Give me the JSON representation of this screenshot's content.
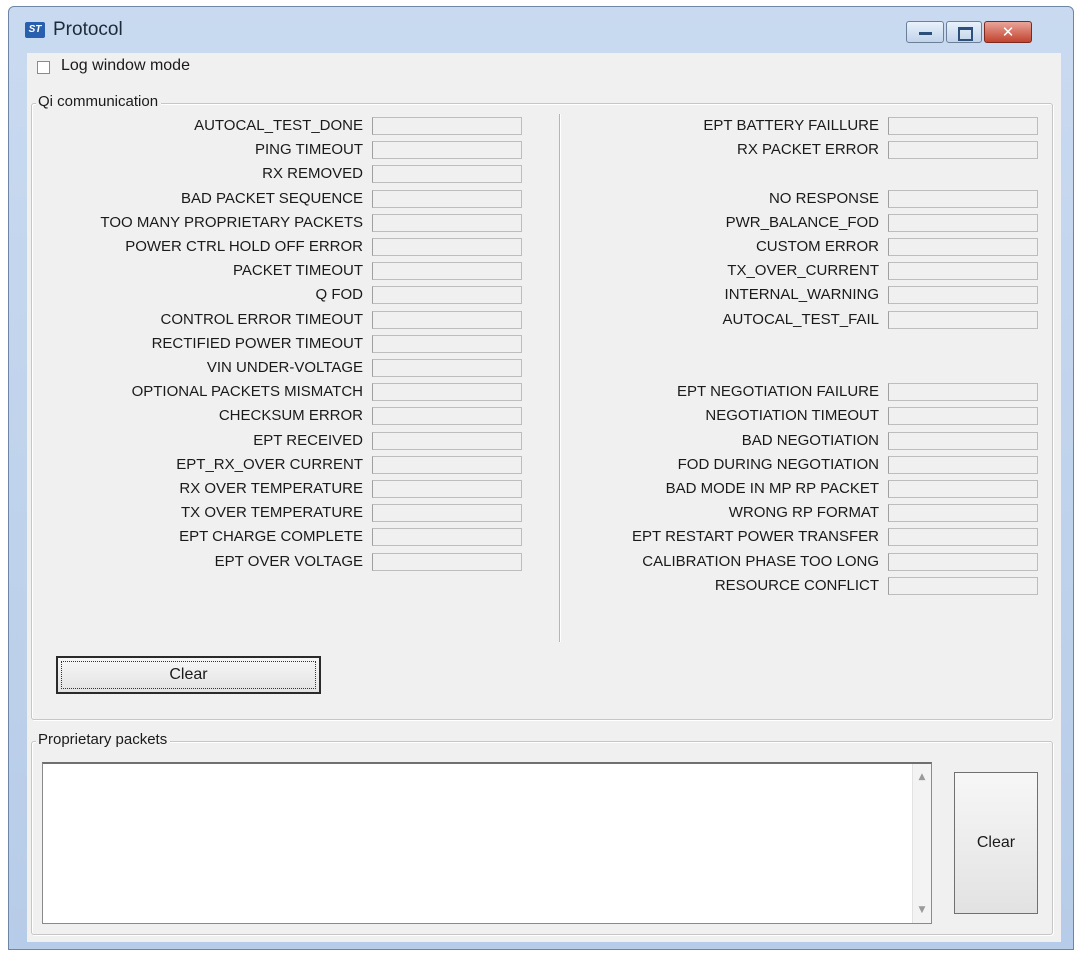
{
  "window": {
    "title": "Protocol",
    "icon": "st-logo-icon",
    "close_glyph": "✕"
  },
  "log_window_mode": {
    "label": "Log window mode",
    "checked": false
  },
  "qi_group": {
    "title": "Qi communication",
    "left_rows": [
      "AUTOCAL_TEST_DONE",
      "PING TIMEOUT",
      "RX REMOVED",
      "BAD PACKET SEQUENCE",
      "TOO MANY PROPRIETARY PACKETS",
      "POWER CTRL HOLD OFF ERROR",
      "PACKET TIMEOUT",
      "Q FOD",
      "CONTROL ERROR TIMEOUT",
      "RECTIFIED POWER TIMEOUT",
      "VIN UNDER-VOLTAGE",
      "OPTIONAL PACKETS MISMATCH",
      "CHECKSUM ERROR",
      "EPT RECEIVED",
      "EPT_RX_OVER CURRENT",
      "RX OVER TEMPERATURE",
      "TX OVER TEMPERATURE",
      "EPT CHARGE COMPLETE",
      "EPT OVER VOLTAGE"
    ],
    "right_rows_a": [
      "EPT BATTERY FAILLURE",
      "RX PACKET ERROR"
    ],
    "right_rows_b": [
      "NO RESPONSE",
      "PWR_BALANCE_FOD",
      "CUSTOM ERROR",
      "TX_OVER_CURRENT",
      "INTERNAL_WARNING",
      "AUTOCAL_TEST_FAIL"
    ],
    "right_rows_c": [
      "EPT NEGOTIATION FAILURE",
      "NEGOTIATION TIMEOUT",
      "BAD NEGOTIATION",
      "FOD DURING NEGOTIATION",
      "BAD MODE IN MP RP PACKET",
      "WRONG RP FORMAT",
      "EPT RESTART POWER TRANSFER",
      "CALIBRATION PHASE TOO LONG",
      "RESOURCE CONFLICT"
    ],
    "clear_label": "Clear"
  },
  "proprietary_group": {
    "title": "Proprietary packets",
    "text": "",
    "clear_label": "Clear"
  }
}
